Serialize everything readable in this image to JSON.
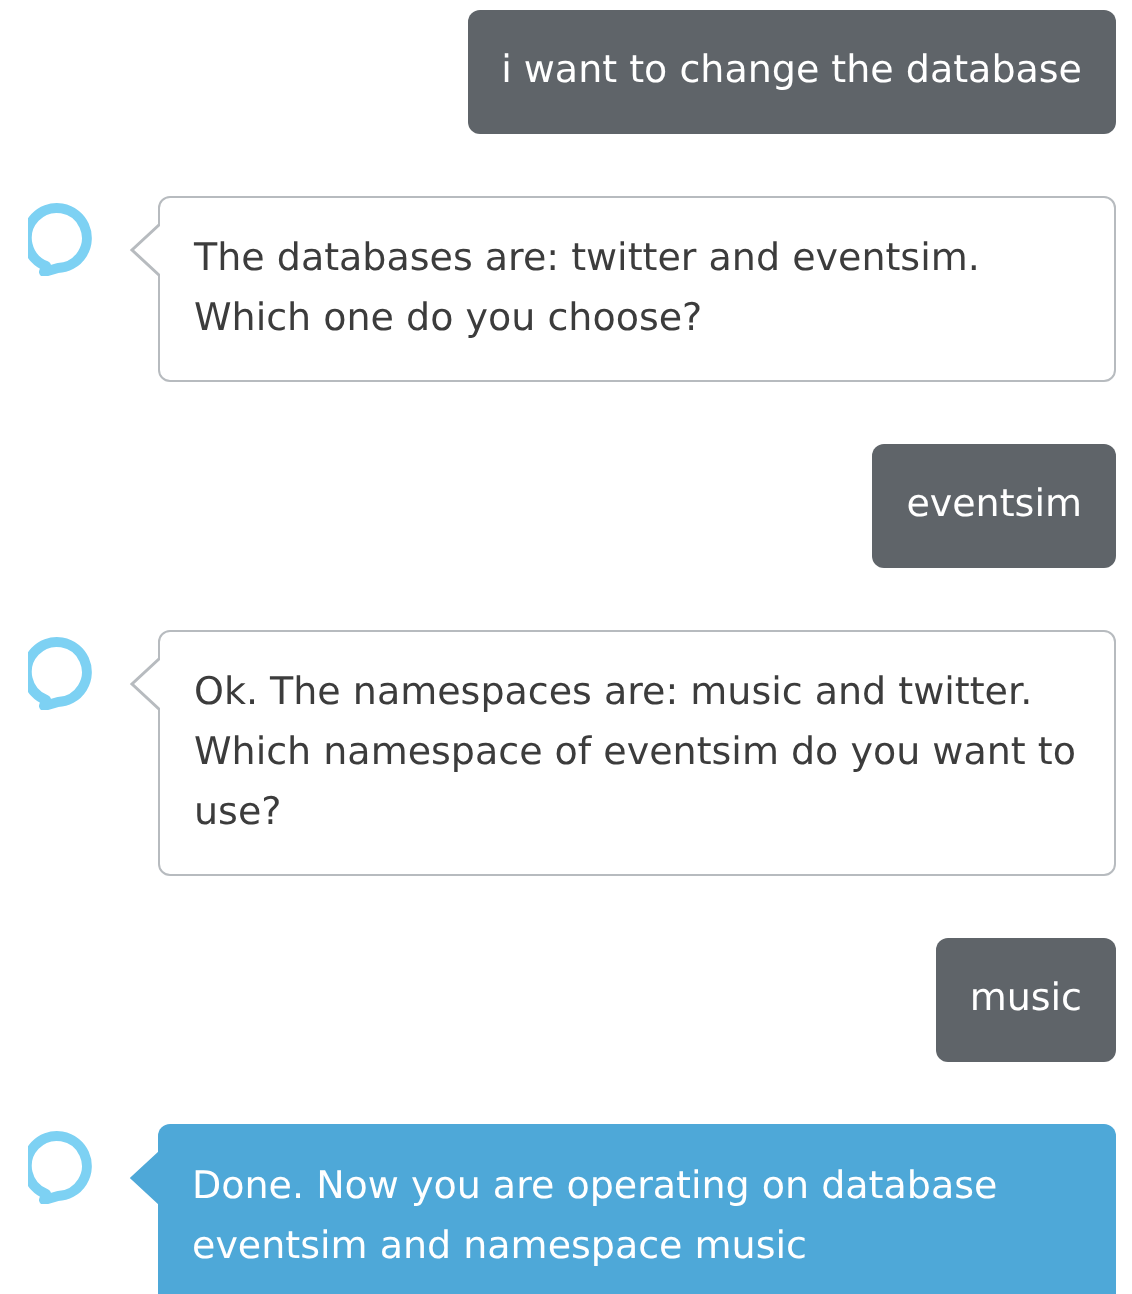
{
  "messages": [
    {
      "kind": "user",
      "text": "i want to change the database"
    },
    {
      "kind": "assistant",
      "highlighted": false,
      "text": "The databases are: twitter and eventsim. Which one do you choose?"
    },
    {
      "kind": "user",
      "text": "eventsim"
    },
    {
      "kind": "assistant",
      "highlighted": false,
      "text": "Ok. The namespaces are: music and twitter. Which namespace of eventsim do you want to use?"
    },
    {
      "kind": "user",
      "text": "music"
    },
    {
      "kind": "assistant",
      "highlighted": true,
      "text": "Done. Now you are operating on database eventsim and namespace music"
    }
  ]
}
